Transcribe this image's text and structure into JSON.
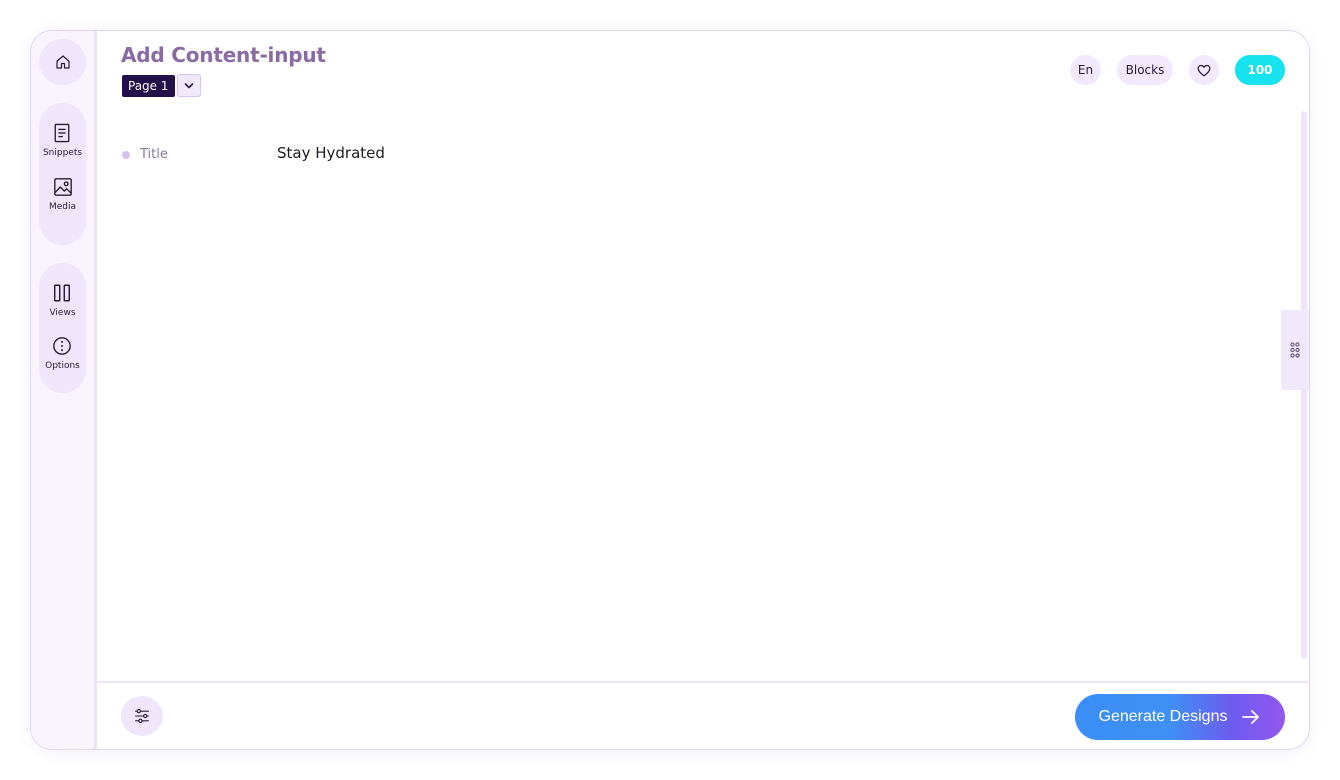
{
  "header": {
    "title": "Add Content-input",
    "page_selected": "Page 1"
  },
  "sidebar": {
    "items": [
      {
        "name": "home",
        "label": "",
        "icon": "home-icon"
      },
      {
        "name": "snippets",
        "label": "Snippets",
        "icon": "document-icon"
      },
      {
        "name": "media",
        "label": "Media",
        "icon": "image-icon"
      },
      {
        "name": "views",
        "label": "Views",
        "icon": "columns-icon"
      },
      {
        "name": "options",
        "label": "Options",
        "icon": "options-icon"
      }
    ]
  },
  "top_actions": {
    "language": "En",
    "blocks": "Blocks",
    "favorite_icon": "heart-icon",
    "credits": "100"
  },
  "fields": [
    {
      "label": "Title",
      "value": "Stay Hydrated"
    }
  ],
  "footer": {
    "filter_icon": "sliders-icon",
    "generate_label": "Generate Designs",
    "generate_icon": "arrow-right-icon"
  },
  "colors": {
    "accent_dark": "#23104a",
    "credits_badge": "#16e3ee",
    "generate_gradient_start": "#3a8ef5",
    "generate_gradient_end": "#9457ee",
    "sidebar_pill": "#f0e6fb"
  }
}
